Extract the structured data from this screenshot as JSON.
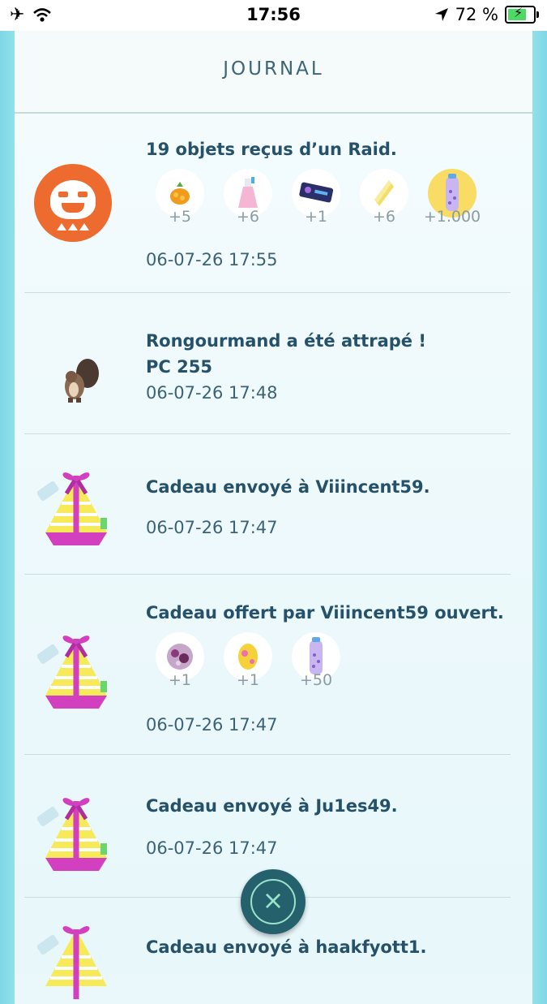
{
  "status_bar": {
    "time": "17:56",
    "battery_text": "72 %",
    "icons": [
      "airplane-icon",
      "wifi-icon",
      "location-arrow-icon",
      "battery-charging-icon"
    ]
  },
  "header": {
    "title": "JOURNAL"
  },
  "entries": [
    {
      "icon": "raid-badge-icon",
      "text": "19 objets reçus  d’un Raid.",
      "items": [
        {
          "icon": "golden-razz-berry-icon",
          "qty": "+5"
        },
        {
          "icon": "potion-icon",
          "qty": "+6"
        },
        {
          "icon": "tm-icon",
          "qty": "+1"
        },
        {
          "icon": "rare-candy-icon",
          "qty": "+6"
        },
        {
          "icon": "stardust-icon",
          "qty": "+1.000"
        }
      ],
      "date": "06-07-26 17:55"
    },
    {
      "icon": "pokemon-icon",
      "text": "Rongourmand a été attrapé !",
      "subtext": "PC 255",
      "date": "06-07-26 17:48"
    },
    {
      "icon": "gift-icon",
      "text": "Cadeau envoyé à Viiincent59.",
      "date": "06-07-26 17:47"
    },
    {
      "icon": "gift-icon",
      "text": "Cadeau offert par Viiincent59 ouvert.",
      "items": [
        {
          "icon": "sticker-icon",
          "qty": "+1"
        },
        {
          "icon": "egg-icon",
          "qty": "+1"
        },
        {
          "icon": "stardust-icon",
          "qty": "+50"
        }
      ],
      "date": "06-07-26 17:47"
    },
    {
      "icon": "gift-icon",
      "text": "Cadeau envoyé à Ju1es49.",
      "date": "06-07-26 17:47"
    },
    {
      "icon": "gift-icon",
      "text": "Cadeau envoyé à haakfyott1."
    }
  ],
  "close_button": {
    "label": "×",
    "icon": "close-icon"
  },
  "colors": {
    "raid_orange": "#ee6b2f",
    "text_dark": "#25516a",
    "gift_pink": "#d23fbf",
    "gift_yellow": "#f6ea58",
    "fab": "#24616d"
  }
}
